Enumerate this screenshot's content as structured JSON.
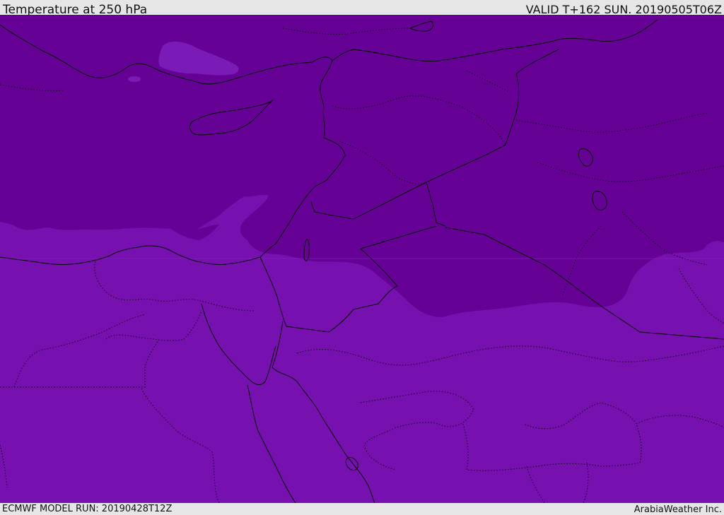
{
  "header": {
    "title": "Temperature at 250 hPa",
    "valid_time": "VALID T+162 SUN. 20190505T06Z"
  },
  "footer": {
    "model_run": "ECMWF MODEL RUN: 20190428T12Z",
    "credit": "ArabiaWeather Inc."
  },
  "map": {
    "region": "Eastern Mediterranean and Middle East",
    "colors": {
      "cold_band": "#650295",
      "warm_band": "#7610ae",
      "pocket": "#7a1bb7",
      "coastline": "#000000"
    }
  }
}
